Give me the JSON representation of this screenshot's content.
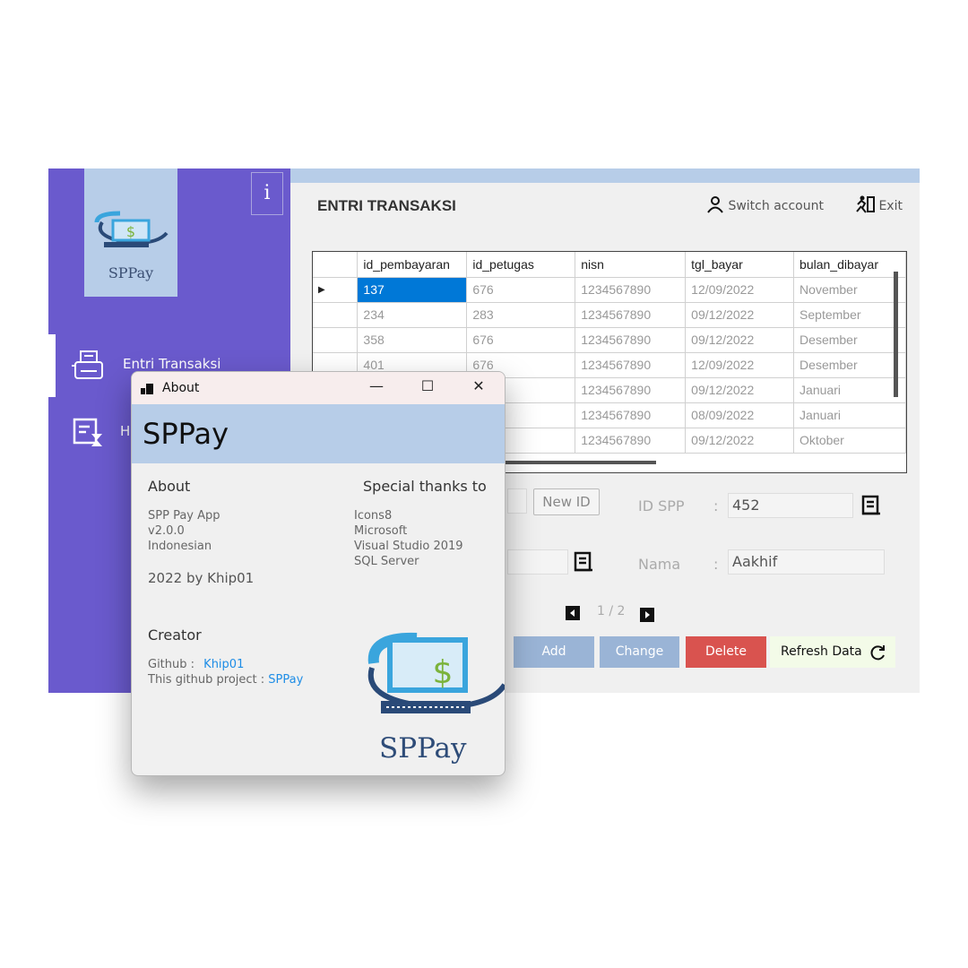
{
  "sidebar": {
    "logo_text": "SPPay",
    "info_label": "i",
    "items": [
      {
        "label": "Entri Transaksi",
        "icon": "typewriter-icon"
      },
      {
        "label": "H",
        "icon": "history-icon"
      }
    ]
  },
  "header": {
    "title": "ENTRI TRANSAKSI",
    "switch_account": "Switch account",
    "exit": "Exit"
  },
  "grid": {
    "columns": [
      "id_pembayaran",
      "id_petugas",
      "nisn",
      "tgl_bayar",
      "bulan_dibayar"
    ],
    "rows": [
      [
        "137",
        "676",
        "1234567890",
        "12/09/2022",
        "November"
      ],
      [
        "234",
        "283",
        "1234567890",
        "09/12/2022",
        "September"
      ],
      [
        "358",
        "676",
        "1234567890",
        "09/12/2022",
        "Desember"
      ],
      [
        "401",
        "676",
        "1234567890",
        "12/09/2022",
        "Desember"
      ],
      [
        "",
        "",
        "1234567890",
        "09/12/2022",
        "Januari"
      ],
      [
        "",
        "",
        "1234567890",
        "08/09/2022",
        "Januari"
      ],
      [
        "",
        "",
        "1234567890",
        "09/12/2022",
        "Oktober"
      ]
    ],
    "current_row_marker": "▶"
  },
  "form": {
    "new_id_label": "New ID",
    "id_spp_label": "ID SPP",
    "id_spp_colon": ":",
    "id_spp_value": "452",
    "nama_label": "Nama",
    "nama_colon": ":",
    "nama_value": "Aakhif"
  },
  "pager": {
    "text": "1 / 2"
  },
  "buttons": {
    "add": "Add",
    "change": "Change",
    "delete": "Delete",
    "refresh": "Refresh Data"
  },
  "about": {
    "window_title": "About",
    "minimize": "—",
    "maximize": "☐",
    "close": "✕",
    "banner": "SPPay",
    "about_heading": "About",
    "app_name": "SPP Pay App",
    "version": "v2.0.0",
    "language": "Indonesian",
    "year_by": "2022 by Khip01",
    "thanks_heading": "Special thanks to",
    "thanks": [
      "Icons8",
      "Microsoft",
      "Visual Studio 2019",
      "SQL Server"
    ],
    "creator_heading": "Creator",
    "github_label": "Github :",
    "github_user": "Khip01",
    "project_label": "This github project :",
    "project_name": "SPPay",
    "logo_text": "SPPay"
  },
  "colors": {
    "sidebar": "#6a5acd",
    "banner": "#b7cde8",
    "selection": "#0078d7",
    "add_button": "#9ab4d6",
    "change_button": "#9ab4d6",
    "delete_button": "#d9534f",
    "link": "#1e8de6"
  }
}
